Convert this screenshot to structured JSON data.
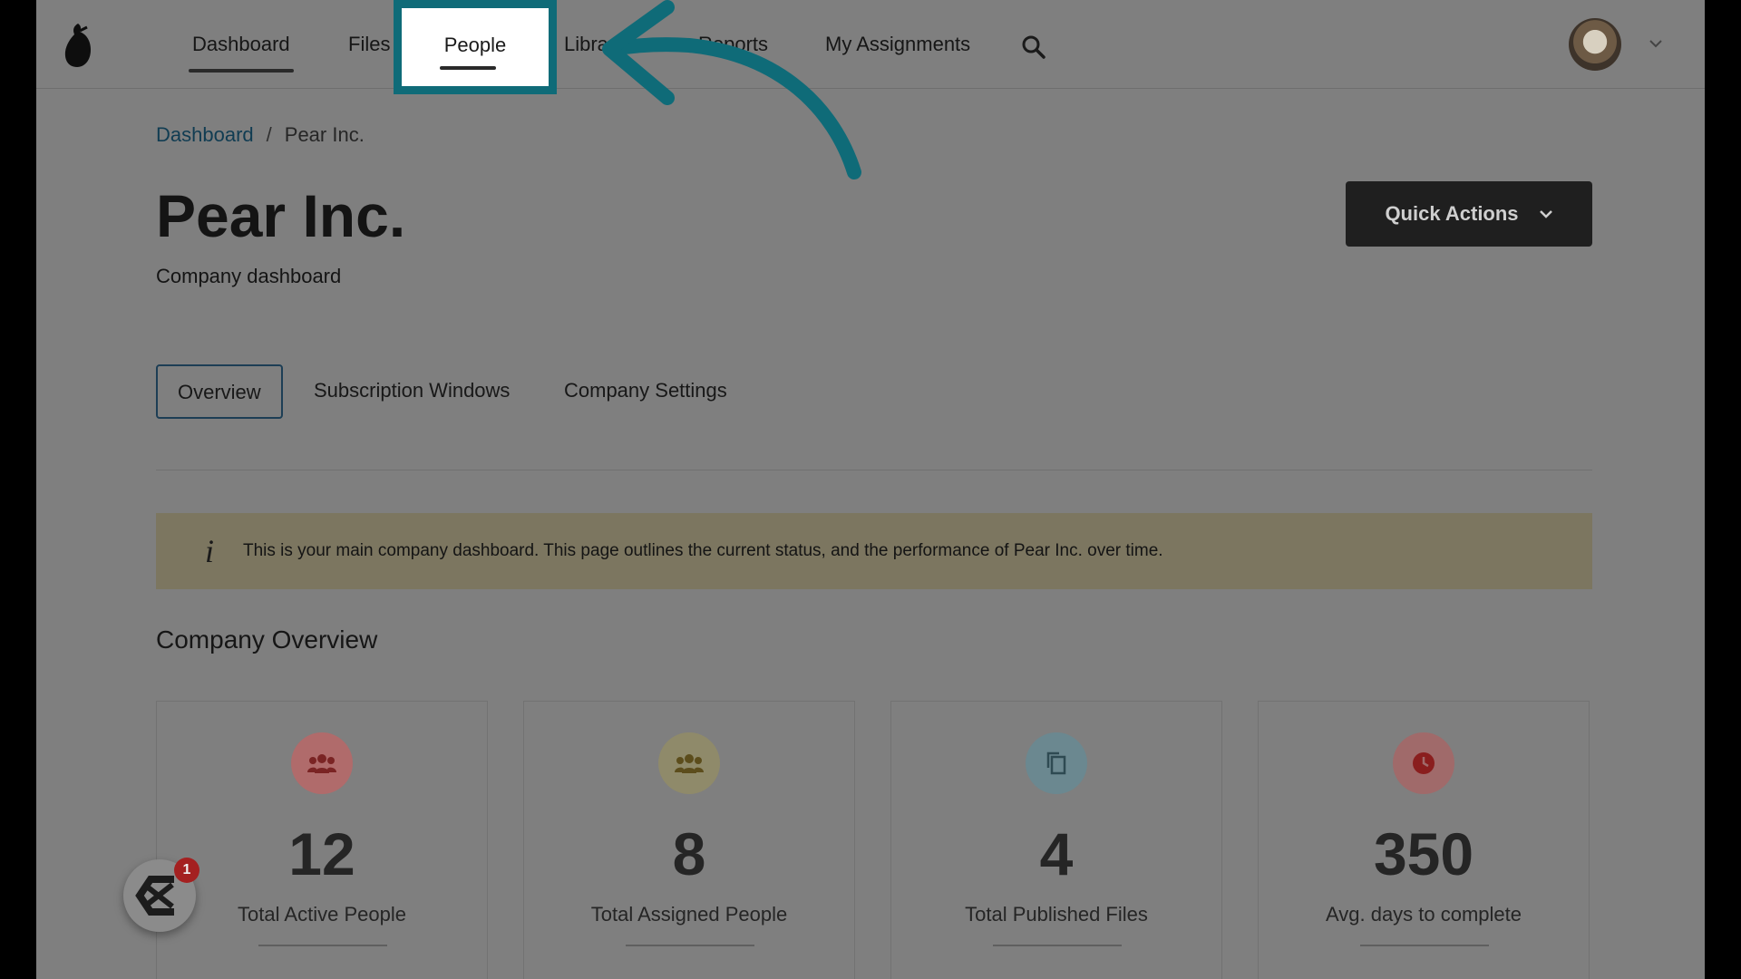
{
  "nav": {
    "items": [
      "Dashboard",
      "Files",
      "People",
      "Libraries",
      "Reports",
      "My Assignments"
    ],
    "active": "Dashboard",
    "highlighted": "People"
  },
  "breadcrumb": {
    "link": "Dashboard",
    "separator": "/",
    "current": "Pear Inc."
  },
  "page": {
    "title": "Pear Inc.",
    "subtitle": "Company dashboard"
  },
  "quick_actions": {
    "label": "Quick Actions"
  },
  "tabs": [
    "Overview",
    "Subscription Windows",
    "Company Settings"
  ],
  "info_banner": {
    "icon": "info-icon",
    "text": "This is your main company dashboard. This page outlines the current status, and the performance of Pear Inc. over time."
  },
  "overview": {
    "title": "Company Overview",
    "cards": [
      {
        "icon": "people-icon",
        "value": "12",
        "label": "Total Active People",
        "color": "#b06b6b"
      },
      {
        "icon": "people-icon",
        "value": "8",
        "label": "Total Assigned People",
        "color": "#8f8a6a"
      },
      {
        "icon": "files-icon",
        "value": "4",
        "label": "Total Published Files",
        "color": "#6b8890"
      },
      {
        "icon": "clock-icon",
        "value": "350",
        "label": "Avg. days to complete",
        "color": "#a06a6a"
      }
    ]
  },
  "chat": {
    "badge": "1"
  },
  "colors": {
    "highlight": "#0f6b78",
    "arrow": "#0f6b78"
  }
}
